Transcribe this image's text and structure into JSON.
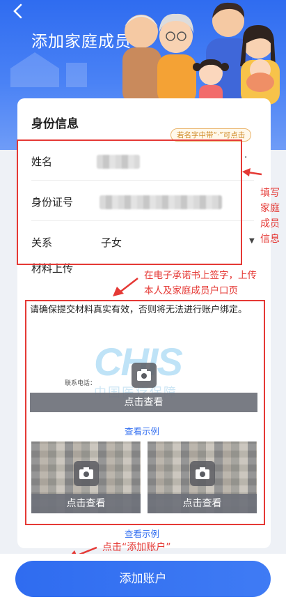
{
  "header": {
    "back_icon": "back-chevron-icon",
    "title": "添加家庭成员"
  },
  "identity": {
    "title": "身份信息",
    "name_tip": "若名字中带“·”可点击",
    "dot_button": "·",
    "name_label": "姓名",
    "id_label": "身份证号",
    "relation_label": "关系",
    "relation_value": "子女"
  },
  "materials": {
    "title": "材料上传",
    "notice": "请确保提交材料真实有效，否则将无法进行账户绑定。",
    "doc_contact_label": "联系电话：",
    "doc_watermark": "CHIS",
    "doc_watermark_sub": "中国医疗保障",
    "view_button": "点击查看",
    "view_example_link": "查看示例"
  },
  "annotations": {
    "fill_info": "填写家庭成员信息",
    "fill_lines": [
      "填写",
      "家庭",
      "成员",
      "信息"
    ],
    "sign_upload": "在电子承诺书上签字，上传本人及家庭成员户口页",
    "sign_lines": [
      "在电子承诺书上签字，上传",
      "本人及家庭成员户口页"
    ],
    "click_add": "点击“添加账户”",
    "color": "#e53935"
  },
  "footer": {
    "submit_label": "添加账户"
  },
  "theme": {
    "primary": "#2f6cf0",
    "tip_orange": "#d08a27"
  }
}
